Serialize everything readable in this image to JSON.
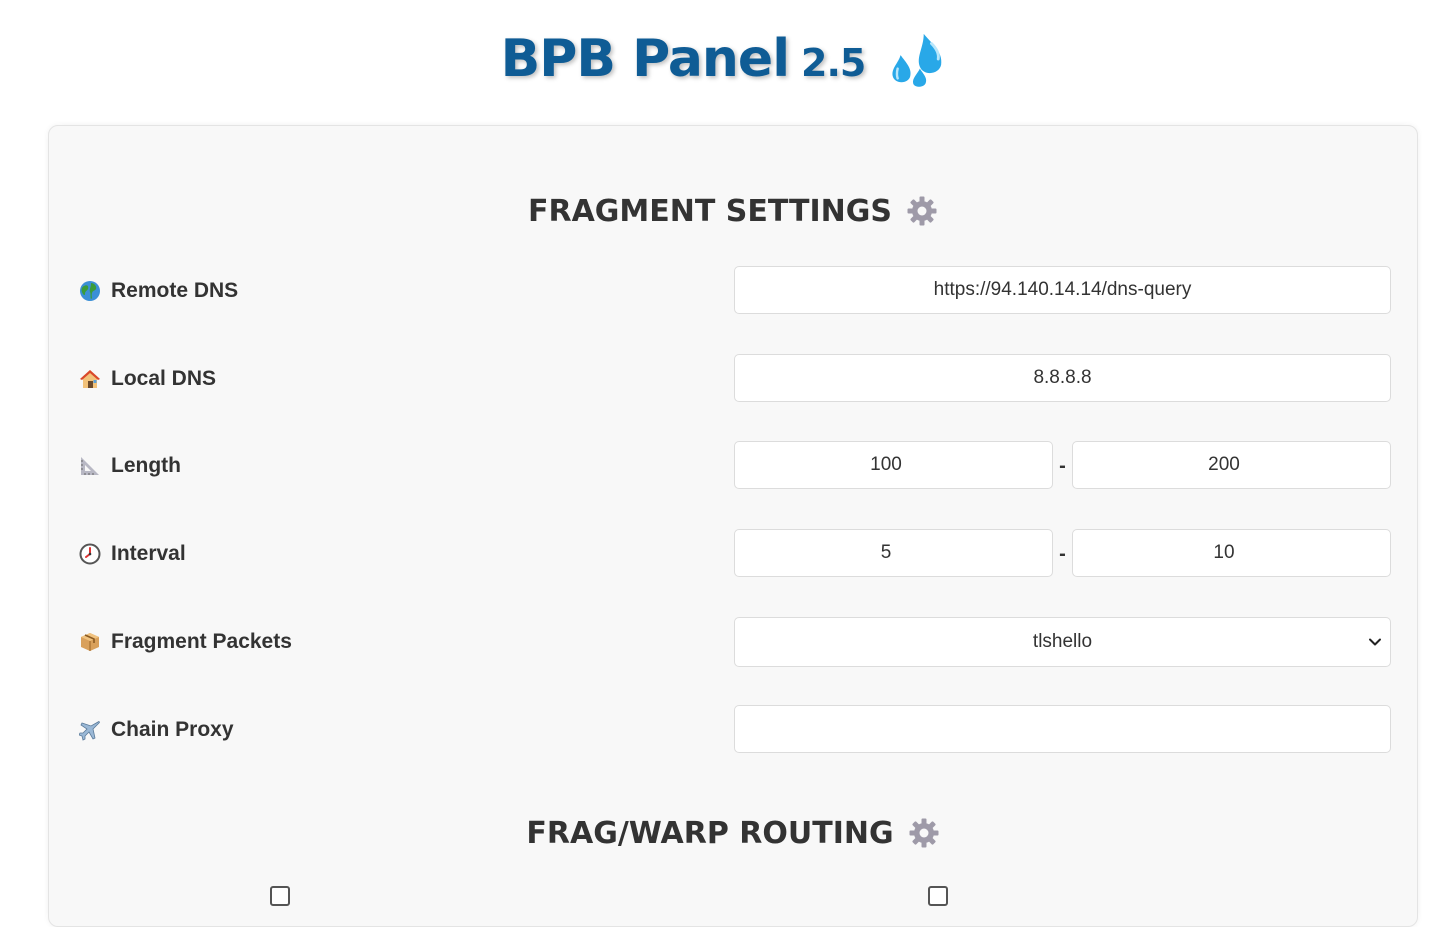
{
  "header": {
    "title": "BPB Panel",
    "version": "2.5",
    "logo_icon": "sweat-droplets-icon"
  },
  "fragment_section": {
    "title": "FRAGMENT SETTINGS",
    "title_icon": "gear-icon",
    "rows": {
      "remote_dns": {
        "label": "Remote DNS",
        "icon": "globe-icon",
        "value": "https://94.140.14.14/dns-query"
      },
      "local_dns": {
        "label": "Local DNS",
        "icon": "house-icon",
        "value": "8.8.8.8"
      },
      "length": {
        "label": "Length",
        "icon": "triangle-ruler-icon",
        "min": "100",
        "max": "200",
        "separator": "-"
      },
      "interval": {
        "label": "Interval",
        "icon": "clock-icon",
        "min": "5",
        "max": "10",
        "separator": "-"
      },
      "fragment_packets": {
        "label": "Fragment Packets",
        "icon": "package-icon",
        "selected": "tlshello"
      },
      "chain_proxy": {
        "label": "Chain Proxy",
        "icon": "airplane-icon",
        "value": ""
      }
    }
  },
  "routing_section": {
    "title": "FRAG/WARP ROUTING",
    "title_icon": "gear-icon"
  },
  "colors": {
    "title": "#0f5c95",
    "heading": "#333333",
    "card_bg": "#f8f8f8",
    "border": "#dcdcdc"
  }
}
